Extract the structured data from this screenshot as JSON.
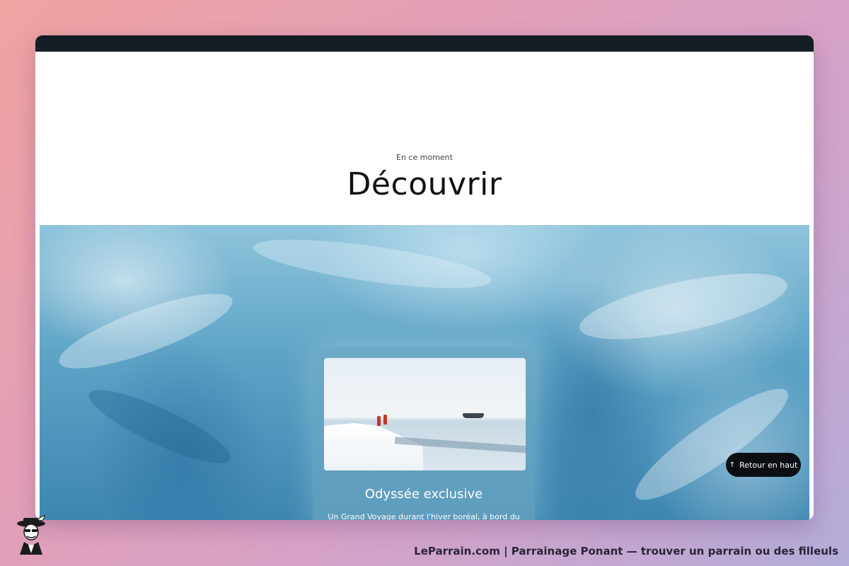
{
  "section": {
    "eyebrow": "En ce moment",
    "title": "Découvrir"
  },
  "card": {
    "title": "Odyssée exclusive",
    "text": "Un Grand Voyage durant l'hiver boréal, à bord du"
  },
  "back_to_top": {
    "label": "Retour en haut",
    "icon": "arrow-up-icon"
  },
  "footer": {
    "caption": "LeParrain.com | Parrainage Ponant — trouver un parrain ou des filleuls"
  },
  "colors": {
    "top_bar": "#141c24",
    "back_to_top_bg": "#0b0f14"
  }
}
